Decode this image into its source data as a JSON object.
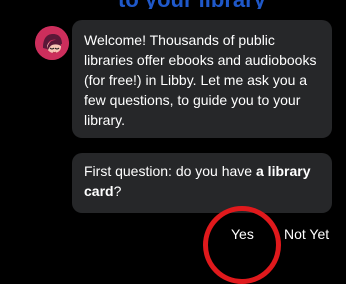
{
  "header": {
    "partial_text": "to your library"
  },
  "messages": {
    "welcome_text": "Welcome! Thousands of public libraries offer ebooks and audiobooks (for free!) in Libby. Let me ask you a few questions, to guide you to your library.",
    "question_prefix": "First question: do you have ",
    "question_bold": "a library card",
    "question_suffix": "?"
  },
  "answers": {
    "yes": "Yes",
    "not_yet": "Not Yet"
  },
  "colors": {
    "background": "#000000",
    "bubble": "#262729",
    "avatar": "#cc2e5c",
    "highlight_circle": "#e0191c",
    "header_text": "#1f58c9"
  },
  "icons": {
    "avatar": "libby-avatar-icon"
  }
}
